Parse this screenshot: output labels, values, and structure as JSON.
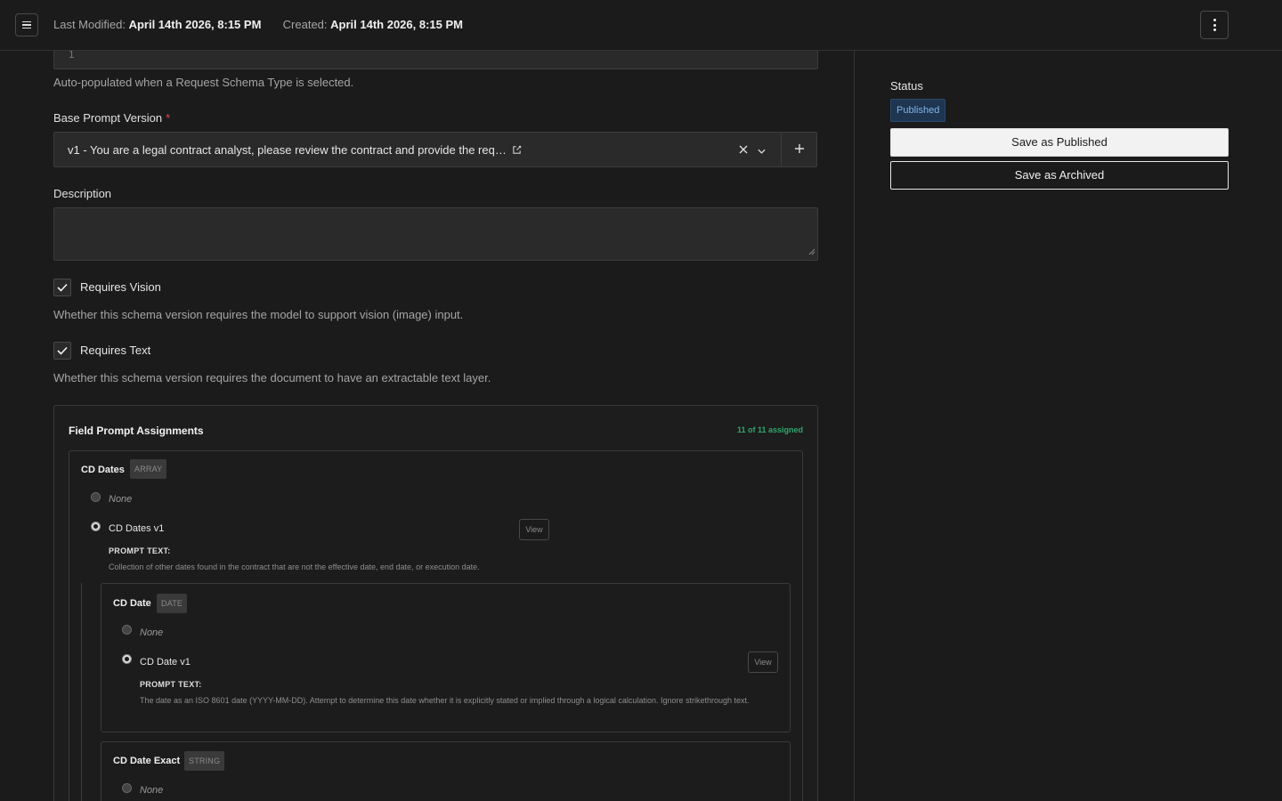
{
  "header": {
    "last_modified_label": "Last Modified:",
    "last_modified_value": "April 14th 2026, 8:15 PM",
    "created_label": "Created:",
    "created_value": "April 14th 2026, 8:15 PM"
  },
  "form": {
    "schema_version_value": "1",
    "schema_version_helper": "Auto-populated when a Request Schema Type is selected.",
    "base_prompt_label": "Base Prompt Version",
    "base_prompt_required": "*",
    "base_prompt_value": "v1 - You are a legal contract analyst, please review the contract and provide the req…",
    "description_label": "Description",
    "description_value": "",
    "requires_vision": {
      "label": "Requires Vision",
      "checked": true,
      "helper": "Whether this schema version requires the model to support vision (image) input."
    },
    "requires_text": {
      "label": "Requires Text",
      "checked": true,
      "helper": "Whether this schema version requires the document to have an extractable text layer."
    }
  },
  "assignments": {
    "title": "Field Prompt Assignments",
    "count": "11 of 11 assigned",
    "fields": [
      {
        "name": "CD Dates",
        "type": "ARRAY",
        "none_label": "None",
        "option_label": "CD Dates v1",
        "selected": "CD Dates v1",
        "view_label": "View",
        "prompt_text_label": "PROMPT TEXT:",
        "prompt_text": "Collection of other dates found in the contract that are not the effective date, end date, or execution date."
      },
      {
        "name": "CD Date",
        "type": "DATE",
        "none_label": "None",
        "option_label": "CD Date v1",
        "selected": "CD Date v1",
        "view_label": "View",
        "prompt_text_label": "PROMPT TEXT:",
        "prompt_text": "The date as an ISO 8601 date (YYYY-MM-DD). Attempt to determine this date whether it is explicitly stated or implied through a logical calculation. Ignore strikethrough text."
      },
      {
        "name": "CD Date Exact",
        "type": "STRING",
        "none_label": "None"
      }
    ]
  },
  "sidebar": {
    "status_label": "Status",
    "status_value": "Published",
    "save_published_label": "Save as Published",
    "save_archived_label": "Save as Archived"
  },
  "colors": {
    "background": "#1b1b1b",
    "required": "#e5484d",
    "assigned_count": "#2fa66a",
    "status_badge": "#7db4ea"
  }
}
